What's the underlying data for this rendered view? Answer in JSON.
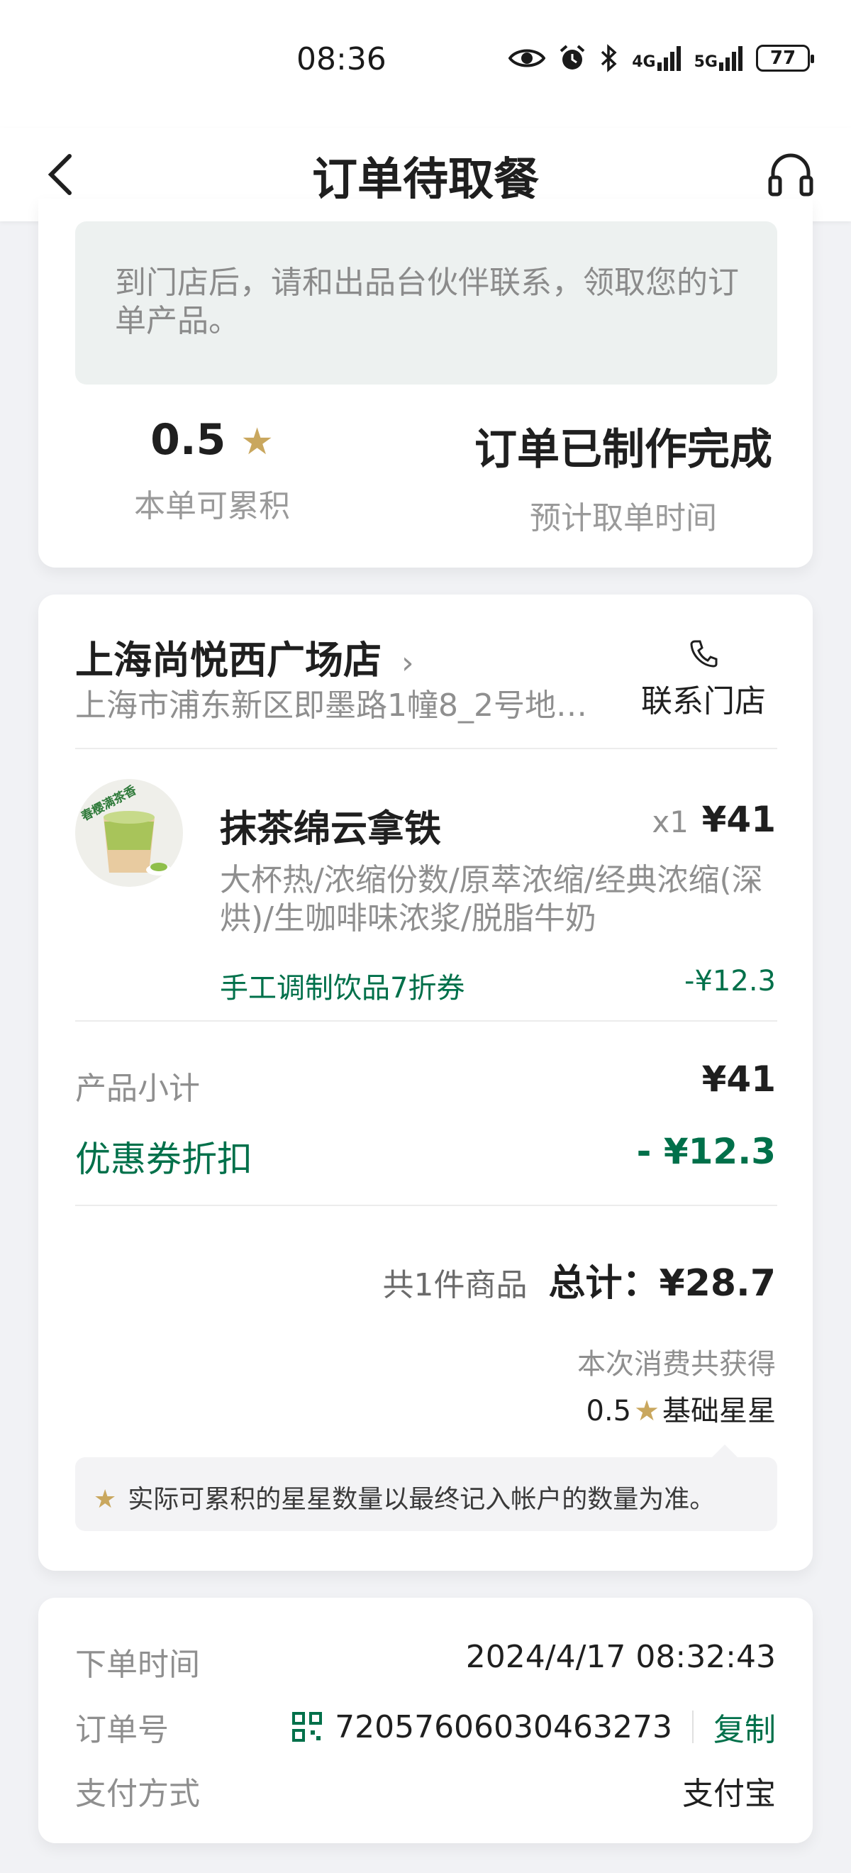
{
  "status_bar": {
    "time": "08:36",
    "network_4g": "4G",
    "network_5g": "5G",
    "battery": "77",
    "icons": [
      "eye-icon",
      "alarm-icon",
      "bluetooth-icon",
      "signal-icon",
      "battery-icon"
    ]
  },
  "header": {
    "title": "订单待取餐",
    "back_icon": "chevron-left-icon",
    "support_icon": "headset-icon"
  },
  "pickup_card": {
    "notice": "到门店后，请和出品台伙伴联系，领取您的订单产品。",
    "stars_value": "0.5",
    "stars_label": "本单可累积",
    "status_value": "订单已制作完成",
    "status_label": "预计取单时间"
  },
  "order_card": {
    "store_name": "上海尚悦西广场店",
    "store_chevron": "›",
    "store_address": "上海市浦东新区即墨路1幢8_2号地…",
    "contact_label": "联系门店",
    "product": {
      "name": "抹茶绵云拿铁",
      "quantity": "x1",
      "price": "¥41",
      "description": "大杯热/浓缩份数/原萃浓缩/经典浓缩(深烘)/生咖啡味浓浆/脱脂牛奶",
      "coupon_name": "手工调制饮品7折券",
      "coupon_amount": "-¥12.3",
      "badge_text": "春樱满茶香"
    },
    "subtotal_label": "产品小计",
    "subtotal_value": "¥41",
    "discount_label": "优惠券折扣",
    "discount_value": "- ¥12.3",
    "item_count": "共1件商品",
    "total": "总计：¥28.7",
    "earned_label": "本次消费共获得",
    "earned_value": "0.5",
    "earned_unit": "基础星星",
    "tip": "实际可累积的星星数量以最终记入帐户的数量为准。"
  },
  "info_card": {
    "order_time_label": "下单时间",
    "order_time_value": "2024/4/17 08:32:43",
    "order_no_label": "订单号",
    "order_no_value": "72057606030463273",
    "copy_label": "复制",
    "payment_label": "支付方式",
    "payment_value": "支付宝"
  },
  "colors": {
    "brand_green": "#00704a",
    "star_gold": "#c9a75e",
    "background": "#f1f2f5"
  }
}
